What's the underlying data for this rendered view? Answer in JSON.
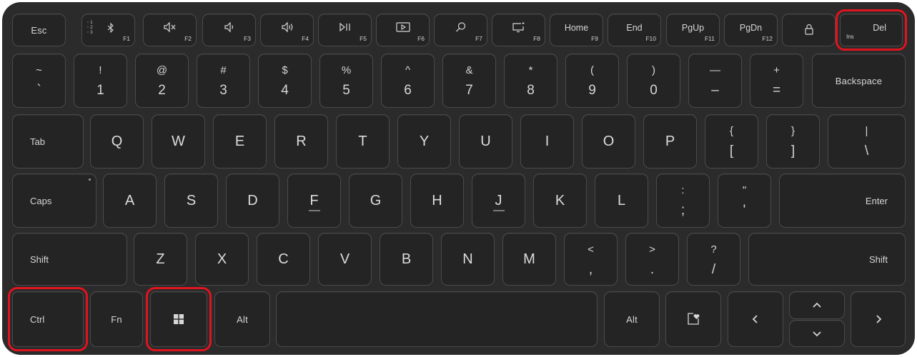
{
  "keyboard": {
    "accent_color": "#e0141e",
    "fn_row": {
      "esc": "Esc",
      "f1": "F1",
      "f2": "F2",
      "f3": "F3",
      "f4": "F4",
      "f5": "F5",
      "f6": "F6",
      "f7": "F7",
      "f8": "F8",
      "home": "Home",
      "f9": "F9",
      "end": "End",
      "f10": "F10",
      "pgup": "PgUp",
      "f11": "F11",
      "pgdn": "PgDn",
      "f12": "F12",
      "ins": "Ins",
      "del": "Del",
      "bt_labels": [
        "1",
        "2",
        "3"
      ]
    },
    "number_row": {
      "keys": [
        {
          "top": "~",
          "bottom": "`"
        },
        {
          "top": "!",
          "bottom": "1"
        },
        {
          "top": "@",
          "bottom": "2"
        },
        {
          "top": "#",
          "bottom": "3"
        },
        {
          "top": "$",
          "bottom": "4"
        },
        {
          "top": "%",
          "bottom": "5"
        },
        {
          "top": "^",
          "bottom": "6"
        },
        {
          "top": "&",
          "bottom": "7"
        },
        {
          "top": "*",
          "bottom": "8"
        },
        {
          "top": "(",
          "bottom": "9"
        },
        {
          "top": ")",
          "bottom": "0"
        },
        {
          "top": "—",
          "bottom": "–"
        },
        {
          "top": "+",
          "bottom": "="
        }
      ],
      "backspace": "Backspace"
    },
    "qwerty_row": {
      "tab": "Tab",
      "letters": [
        "Q",
        "W",
        "E",
        "R",
        "T",
        "Y",
        "U",
        "I",
        "O",
        "P"
      ],
      "brackets": [
        {
          "top": "{",
          "bottom": "["
        },
        {
          "top": "}",
          "bottom": "]"
        }
      ],
      "pipe": {
        "top": "|",
        "bottom": "\\"
      }
    },
    "home_row": {
      "caps": "Caps",
      "letters": [
        "A",
        "S",
        "D",
        "F",
        "G",
        "H",
        "J",
        "K",
        "L"
      ],
      "semicolon": {
        "top": ":",
        "bottom": ";"
      },
      "quote": {
        "top": "\"",
        "bottom": "'"
      },
      "enter": "Enter"
    },
    "shift_row": {
      "shift_left": "Shift",
      "letters": [
        "Z",
        "X",
        "C",
        "V",
        "B",
        "N",
        "M"
      ],
      "comma": {
        "top": "<",
        "bottom": ","
      },
      "period": {
        "top": ">",
        "bottom": "."
      },
      "slash": {
        "top": "?",
        "bottom": "/"
      },
      "shift_right": "Shift"
    },
    "bottom_row": {
      "ctrl": "Ctrl",
      "fn": "Fn",
      "alt_left": "Alt",
      "alt_right": "Alt"
    },
    "highlighted_keys": [
      "Del",
      "Ctrl",
      "Windows"
    ]
  }
}
